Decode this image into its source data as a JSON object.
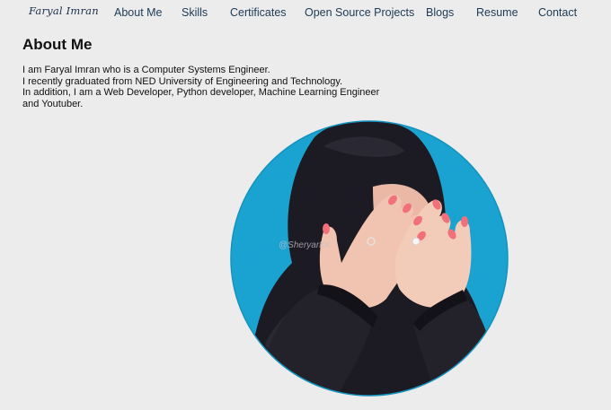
{
  "navbar": {
    "logo": "Faryal Imran",
    "links": [
      {
        "label": "About Me"
      },
      {
        "label": "Skills"
      },
      {
        "label": "Certificates"
      },
      {
        "label": "Open Source Projects"
      },
      {
        "label": "Blogs"
      },
      {
        "label": "Resume"
      },
      {
        "label": "Contact"
      }
    ]
  },
  "about": {
    "title": "About Me",
    "lines": [
      "I am Faryal Imran who is a Computer Systems Engineer.",
      "I recently graduated from NED University of Engineering and Technology.",
      "In addition, I am a Web Developer, Python developer, Machine Learning Engineer",
      "and Youtuber."
    ]
  },
  "profile_image": {
    "watermark": "@SheryarKK",
    "background_color": "#1aa3d1",
    "hijab_color": "#1c1a22",
    "skin_color": "#f0c4b0",
    "nail_color": "#f2707a"
  }
}
